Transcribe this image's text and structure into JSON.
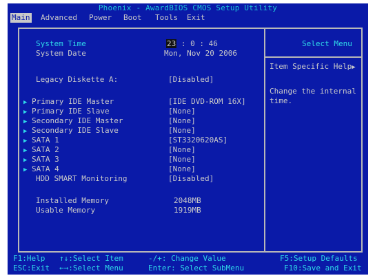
{
  "title": "Phoenix - AwardBIOS CMOS Setup Utility",
  "menu": [
    {
      "label": "Main",
      "active": true
    },
    {
      "label": "Advanced",
      "active": false
    },
    {
      "label": "Power",
      "active": false
    },
    {
      "label": "Boot",
      "active": false
    },
    {
      "label": "Tools",
      "active": false
    },
    {
      "label": "Exit",
      "active": false
    }
  ],
  "main": {
    "system_time_label": "System Time",
    "system_time_hour": "23",
    "system_time_rest": ":  0 : 46",
    "system_date_label": "System Date",
    "system_date_value": "Mon, Nov 20 2006",
    "legacy_label": "Legacy Diskette A:",
    "legacy_value": "[Disabled]",
    "items": [
      {
        "label": "Primary IDE Master",
        "value": "[IDE DVD-ROM 16X]"
      },
      {
        "label": "Primary IDE Slave",
        "value": "[None]"
      },
      {
        "label": "Secondary IDE Master",
        "value": "[None]"
      },
      {
        "label": "Secondary IDE Slave",
        "value": "[None]"
      },
      {
        "label": "SATA 1",
        "value": "[ST3320620AS]"
      },
      {
        "label": "SATA 2",
        "value": "[None]"
      },
      {
        "label": "SATA 3",
        "value": "[None]"
      },
      {
        "label": "SATA 4",
        "value": "[None]"
      }
    ],
    "smart_label": "HDD SMART Monitoring",
    "smart_value": "[Disabled]",
    "installed_label": "Installed Memory",
    "installed_value": "2048MB",
    "usable_label": "Usable Memory",
    "usable_value": "1919MB"
  },
  "help": {
    "header": "Select Menu",
    "specific_label": "Item Specific Help",
    "text_line1": "Change the internal",
    "text_line2": "time."
  },
  "status": {
    "f1": "F1:Help",
    "select_item": "↑↓:Select Item",
    "change_value": "-/+: Change Value",
    "setup_defaults": "F5:Setup Defaults",
    "esc": "ESC:Exit",
    "select_menu": "←→:Select Menu",
    "enter": "Enter: Select SubMenu",
    "save_exit": "F10:Save and Exit"
  },
  "colors": {
    "background": "#0a1aa8",
    "text": "#c9c9c9",
    "highlight": "#2fd8e8"
  }
}
